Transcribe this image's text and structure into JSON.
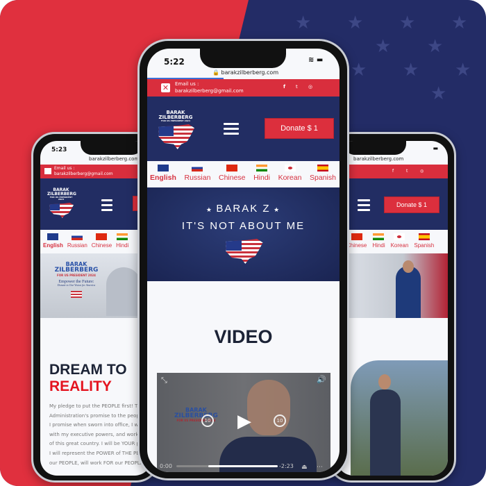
{
  "colors": {
    "red": "#e0303e",
    "navy": "#232c66",
    "accent_red": "#d92e3d"
  },
  "site": {
    "url": "barakzilberberg.com",
    "email_label": "Email us :",
    "email": "barakzilberberg@gmail.com",
    "social_icons": [
      "facebook-icon",
      "twitter-icon",
      "instagram-icon"
    ],
    "logo": {
      "line1": "BARAK",
      "line2": "ZILBERBERG",
      "line3": "FOR US PRESIDENT 2024"
    },
    "donate_label": "Donate $ 1",
    "languages": [
      {
        "label": "English",
        "flag": "uk-flag-icon"
      },
      {
        "label": "Russian",
        "flag": "russia-flag-icon"
      },
      {
        "label": "Chinese",
        "flag": "china-flag-icon"
      },
      {
        "label": "Hindi",
        "flag": "india-flag-icon"
      },
      {
        "label": "Korean",
        "flag": "korea-flag-icon"
      },
      {
        "label": "Spanish",
        "flag": "spain-flag-icon"
      }
    ]
  },
  "left_phone": {
    "time": "5:23",
    "hero": {
      "name1": "BARAK",
      "name2": "ZILBERBERG",
      "sub": "FOR US PRESIDENT 2024",
      "tag1": "Empower the Future:",
      "tag2": "Donate to Our Vision for America"
    },
    "heading1": "DREAM TO",
    "heading2": "REALITY",
    "paragraph": [
      "My pledge to put the PEOPLE first! Th",
      "Administration's promise to the peopl",
      "I promise when sworn into office, I will",
      "with my executive powers, and work f",
      "of this great country. I will be YOUR pu",
      "I will represent the POWER of THE PEO",
      "our PEOPLE, will work FOR our PEOPLE &"
    ]
  },
  "center_phone": {
    "time": "5:22",
    "banner": {
      "line1": "BARAK Z",
      "line2": "IT'S NOT ABOUT ME"
    },
    "section_title": "VIDEO",
    "video": {
      "current": "0:00",
      "remaining": "-2:23",
      "skip_back": "10",
      "skip_forward": "10",
      "overlay_name1": "BARAK",
      "overlay_name2": "ZILBERBERG",
      "overlay_sub": "FOR US PRESIDENT 2024",
      "progress": 0
    }
  },
  "right_phone": {}
}
